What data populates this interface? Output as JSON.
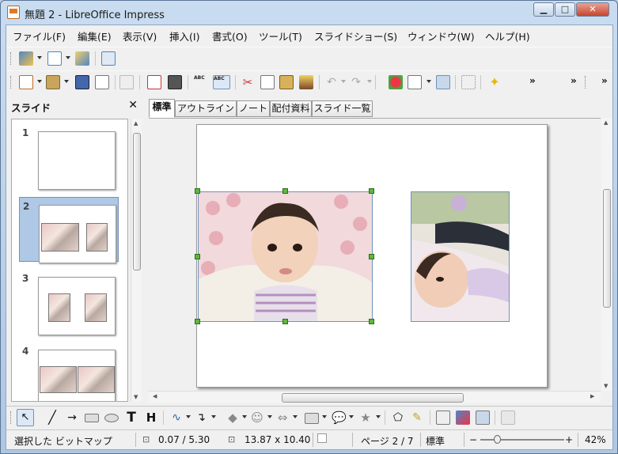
{
  "window": {
    "title": "無題 2 - LibreOffice Impress",
    "minimize": "▁",
    "maximize": "□",
    "close": "✕"
  },
  "menu": [
    "ファイル(F)",
    "編集(E)",
    "表示(V)",
    "挿入(I)",
    "書式(O)",
    "ツール(T)",
    "スライドショー(S)",
    "ウィンドウ(W)",
    "ヘルプ(H)"
  ],
  "toolbar": {
    "more1": "»",
    "more2": "»",
    "more3": "»",
    "spell_a": "ABC",
    "spell_b": "ABC"
  },
  "slides_panel": {
    "title": "スライド",
    "close": "✕",
    "numbers": [
      "1",
      "2",
      "3",
      "4"
    ],
    "selected": 2
  },
  "view_tabs": [
    "標準",
    "アウトライン",
    "ノート",
    "配付資料",
    "スライド一覧"
  ],
  "status": {
    "selection": "選択した ビットマップ",
    "position": "0.07 / 5.30",
    "size": "13.87 x 10.40",
    "page": "ページ 2 / 7",
    "layout": "標準",
    "zoom": "42%",
    "zoom_minus": "−",
    "zoom_plus": "+",
    "zoom_level": 0.42
  },
  "colors": {
    "selection": "#aec8e6",
    "handle": "#5cb83a",
    "accent": "#6f92bd"
  }
}
